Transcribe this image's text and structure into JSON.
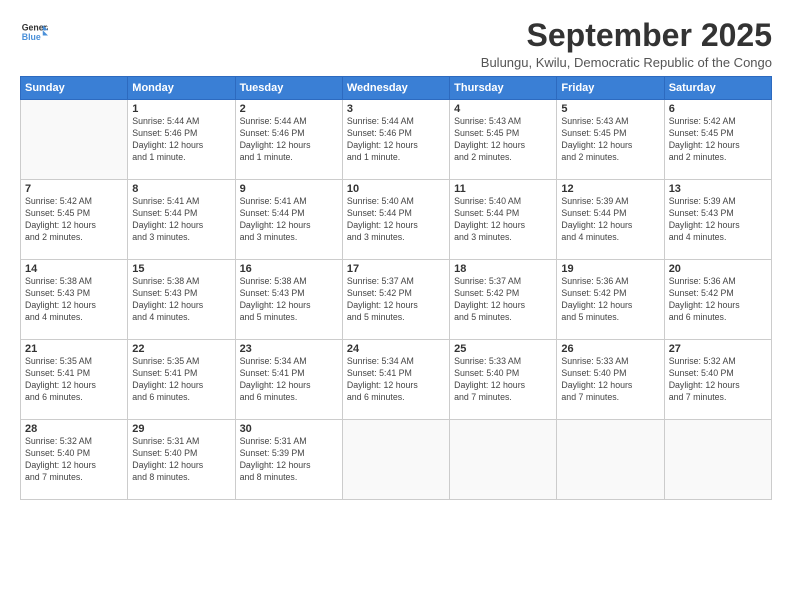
{
  "header": {
    "logo_line1": "General",
    "logo_line2": "Blue",
    "month": "September 2025",
    "location": "Bulungu, Kwilu, Democratic Republic of the Congo"
  },
  "days_of_week": [
    "Sunday",
    "Monday",
    "Tuesday",
    "Wednesday",
    "Thursday",
    "Friday",
    "Saturday"
  ],
  "weeks": [
    [
      {
        "day": "",
        "info": ""
      },
      {
        "day": "1",
        "info": "Sunrise: 5:44 AM\nSunset: 5:46 PM\nDaylight: 12 hours\nand 1 minute."
      },
      {
        "day": "2",
        "info": "Sunrise: 5:44 AM\nSunset: 5:46 PM\nDaylight: 12 hours\nand 1 minute."
      },
      {
        "day": "3",
        "info": "Sunrise: 5:44 AM\nSunset: 5:46 PM\nDaylight: 12 hours\nand 1 minute."
      },
      {
        "day": "4",
        "info": "Sunrise: 5:43 AM\nSunset: 5:45 PM\nDaylight: 12 hours\nand 2 minutes."
      },
      {
        "day": "5",
        "info": "Sunrise: 5:43 AM\nSunset: 5:45 PM\nDaylight: 12 hours\nand 2 minutes."
      },
      {
        "day": "6",
        "info": "Sunrise: 5:42 AM\nSunset: 5:45 PM\nDaylight: 12 hours\nand 2 minutes."
      }
    ],
    [
      {
        "day": "7",
        "info": "Sunrise: 5:42 AM\nSunset: 5:45 PM\nDaylight: 12 hours\nand 2 minutes."
      },
      {
        "day": "8",
        "info": "Sunrise: 5:41 AM\nSunset: 5:44 PM\nDaylight: 12 hours\nand 3 minutes."
      },
      {
        "day": "9",
        "info": "Sunrise: 5:41 AM\nSunset: 5:44 PM\nDaylight: 12 hours\nand 3 minutes."
      },
      {
        "day": "10",
        "info": "Sunrise: 5:40 AM\nSunset: 5:44 PM\nDaylight: 12 hours\nand 3 minutes."
      },
      {
        "day": "11",
        "info": "Sunrise: 5:40 AM\nSunset: 5:44 PM\nDaylight: 12 hours\nand 3 minutes."
      },
      {
        "day": "12",
        "info": "Sunrise: 5:39 AM\nSunset: 5:44 PM\nDaylight: 12 hours\nand 4 minutes."
      },
      {
        "day": "13",
        "info": "Sunrise: 5:39 AM\nSunset: 5:43 PM\nDaylight: 12 hours\nand 4 minutes."
      }
    ],
    [
      {
        "day": "14",
        "info": "Sunrise: 5:38 AM\nSunset: 5:43 PM\nDaylight: 12 hours\nand 4 minutes."
      },
      {
        "day": "15",
        "info": "Sunrise: 5:38 AM\nSunset: 5:43 PM\nDaylight: 12 hours\nand 4 minutes."
      },
      {
        "day": "16",
        "info": "Sunrise: 5:38 AM\nSunset: 5:43 PM\nDaylight: 12 hours\nand 5 minutes."
      },
      {
        "day": "17",
        "info": "Sunrise: 5:37 AM\nSunset: 5:42 PM\nDaylight: 12 hours\nand 5 minutes."
      },
      {
        "day": "18",
        "info": "Sunrise: 5:37 AM\nSunset: 5:42 PM\nDaylight: 12 hours\nand 5 minutes."
      },
      {
        "day": "19",
        "info": "Sunrise: 5:36 AM\nSunset: 5:42 PM\nDaylight: 12 hours\nand 5 minutes."
      },
      {
        "day": "20",
        "info": "Sunrise: 5:36 AM\nSunset: 5:42 PM\nDaylight: 12 hours\nand 6 minutes."
      }
    ],
    [
      {
        "day": "21",
        "info": "Sunrise: 5:35 AM\nSunset: 5:41 PM\nDaylight: 12 hours\nand 6 minutes."
      },
      {
        "day": "22",
        "info": "Sunrise: 5:35 AM\nSunset: 5:41 PM\nDaylight: 12 hours\nand 6 minutes."
      },
      {
        "day": "23",
        "info": "Sunrise: 5:34 AM\nSunset: 5:41 PM\nDaylight: 12 hours\nand 6 minutes."
      },
      {
        "day": "24",
        "info": "Sunrise: 5:34 AM\nSunset: 5:41 PM\nDaylight: 12 hours\nand 6 minutes."
      },
      {
        "day": "25",
        "info": "Sunrise: 5:33 AM\nSunset: 5:40 PM\nDaylight: 12 hours\nand 7 minutes."
      },
      {
        "day": "26",
        "info": "Sunrise: 5:33 AM\nSunset: 5:40 PM\nDaylight: 12 hours\nand 7 minutes."
      },
      {
        "day": "27",
        "info": "Sunrise: 5:32 AM\nSunset: 5:40 PM\nDaylight: 12 hours\nand 7 minutes."
      }
    ],
    [
      {
        "day": "28",
        "info": "Sunrise: 5:32 AM\nSunset: 5:40 PM\nDaylight: 12 hours\nand 7 minutes."
      },
      {
        "day": "29",
        "info": "Sunrise: 5:31 AM\nSunset: 5:40 PM\nDaylight: 12 hours\nand 8 minutes."
      },
      {
        "day": "30",
        "info": "Sunrise: 5:31 AM\nSunset: 5:39 PM\nDaylight: 12 hours\nand 8 minutes."
      },
      {
        "day": "",
        "info": ""
      },
      {
        "day": "",
        "info": ""
      },
      {
        "day": "",
        "info": ""
      },
      {
        "day": "",
        "info": ""
      }
    ]
  ]
}
